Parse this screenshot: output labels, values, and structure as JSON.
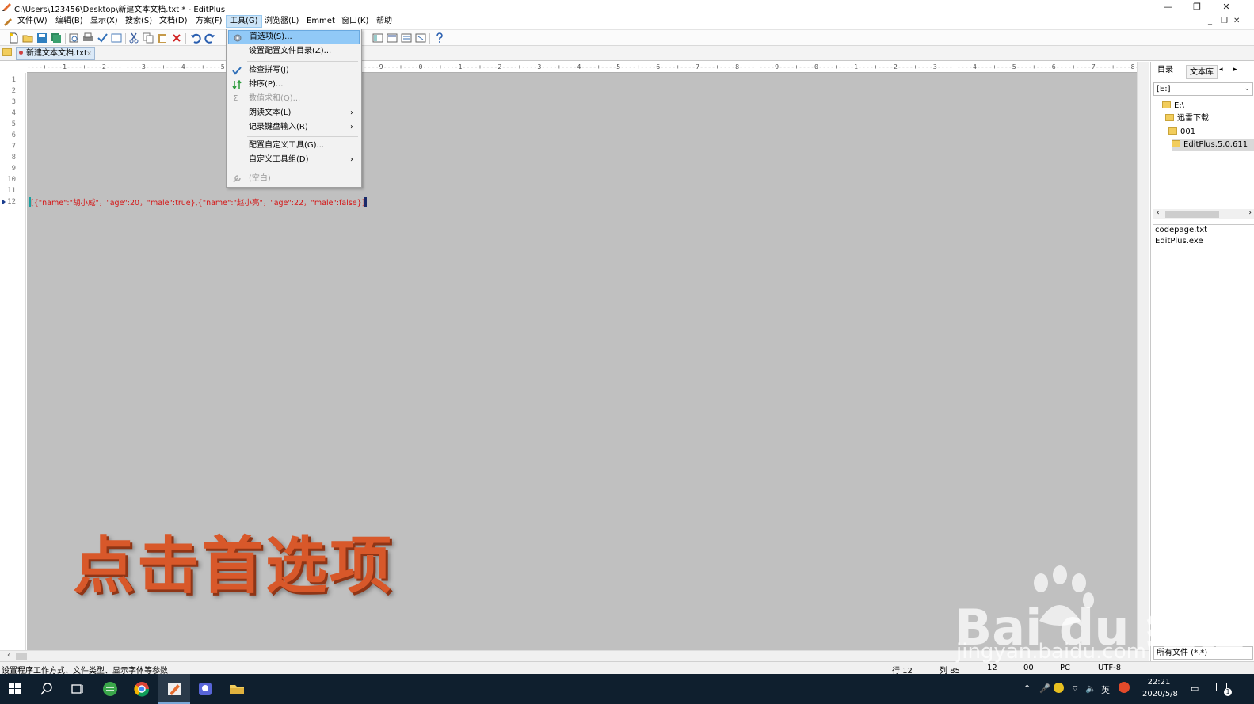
{
  "window": {
    "title": "C:\\Users\\123456\\Desktop\\新建文本文档.txt * - EditPlus",
    "minimize": "—",
    "restore": "❐",
    "close": "✕"
  },
  "menubar": {
    "items": [
      {
        "label": "文件(W)"
      },
      {
        "label": "编辑(B)"
      },
      {
        "label": "显示(X)"
      },
      {
        "label": "搜索(S)"
      },
      {
        "label": "文档(D)"
      },
      {
        "label": "方案(F)"
      },
      {
        "label": "工具(G)"
      },
      {
        "label": "浏览器(L)"
      },
      {
        "label": "Emmet"
      },
      {
        "label": "窗口(K)"
      },
      {
        "label": "帮助"
      }
    ],
    "mdi_min": "_",
    "mdi_restore": "❐",
    "mdi_close": "✕"
  },
  "tabs": {
    "doc_tab": "新建文本文档.txt"
  },
  "ruler": {
    "text": "----+----1----+----2----+----3----+----4----+----5----+----6----+----7----+----8----+----9----+----0----+----1----+----2----+----3----+----4----+----5----+----6----+----7----+----8----+----9----+----0----+----1----+----2----+----3----+----4----+----5----+----6----+----7----+----8----+"
  },
  "editor": {
    "line_numbers": [
      "1",
      "2",
      "3",
      "4",
      "5",
      "6",
      "7",
      "8",
      "9",
      "10",
      "11",
      "12"
    ],
    "code_line_12": "[{\"name\":\"胡小威\"，\"age\":20，\"male\":true},{\"name\":\"赵小亮\"，\"age\":22，\"male\":false}]"
  },
  "dropdown": {
    "items": [
      {
        "label": "首选项(S)..."
      },
      {
        "label": "设置配置文件目录(Z)..."
      },
      {
        "label": "检查拼写(J)"
      },
      {
        "label": "排序(P)..."
      },
      {
        "label": "数值求和(Q)..."
      },
      {
        "label": "朗读文本(L)"
      },
      {
        "label": "记录键盘输入(R)"
      },
      {
        "label": "配置自定义工具(G)..."
      },
      {
        "label": "自定义工具组(D)"
      },
      {
        "label": "(空白)"
      }
    ],
    "arrow": "›"
  },
  "side_panel": {
    "tab_dir": "目录",
    "tab_lib": "文本库",
    "drive": "[E:]",
    "tree": [
      "E:\\",
      "迅雷下载",
      "001",
      "EditPlus.5.0.611"
    ],
    "files": [
      "codepage.txt",
      "EditPlus.exe"
    ],
    "filter": "所有文件 (*.*)"
  },
  "statusbar": {
    "message": "设置程序工作方式、文件类型、显示字体等参数",
    "row": "行 12",
    "col": "列 85",
    "pos": "12",
    "code": "00",
    "eol": "PC",
    "encoding": "UTF-8"
  },
  "overlay": {
    "caption": "点击首选项",
    "watermark_brand": "Bai du 经验",
    "watermark_url": "jingyan.baidu.com"
  },
  "taskbar": {
    "clock_time": "22:21",
    "clock_date": "2020/5/8",
    "ime": "英",
    "notify_count": "1"
  }
}
